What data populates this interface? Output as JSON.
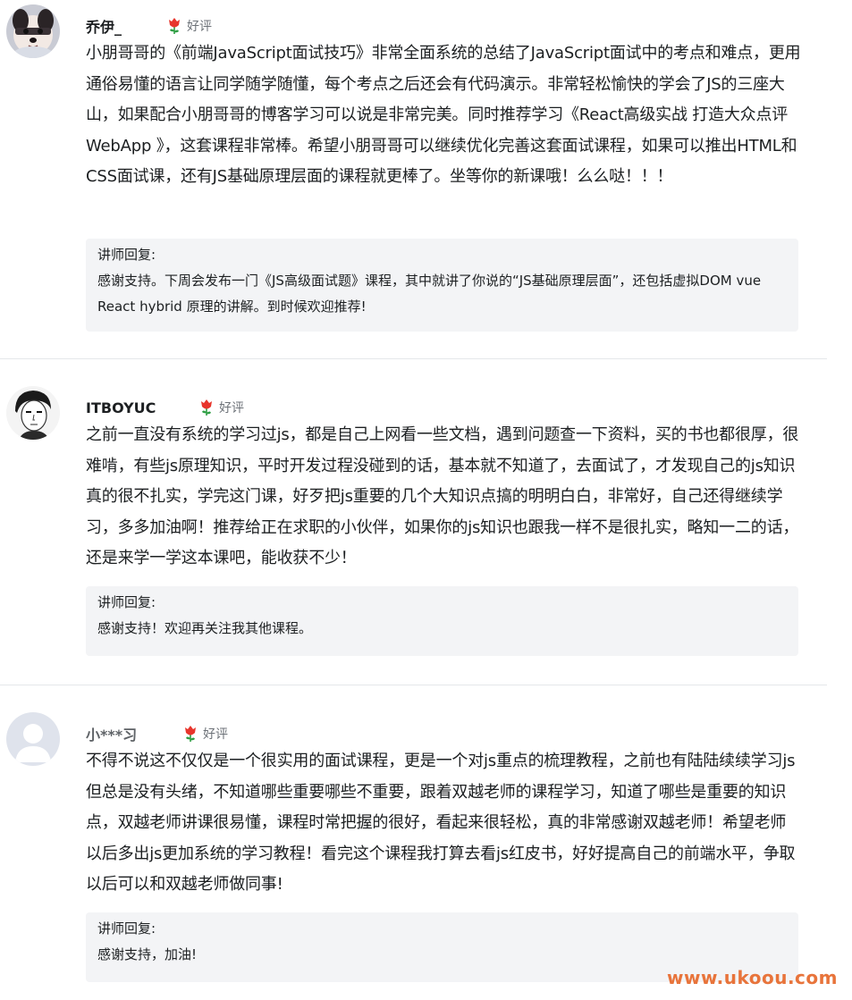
{
  "reviews": [
    {
      "username": "乔伊_",
      "avatar": "puppy-avatar",
      "rating_icon": "rose-icon",
      "rating_label": "好评",
      "content": "小朋哥哥的《前端JavaScript面试技巧》非常全面系统的总结了JavaScript面试中的考点和难点，更用通俗易懂的语言让同学随学随懂，每个考点之后还会有代码演示。非常轻松愉快的学会了JS的三座大山，如果配合小朋哥哥的博客学习可以说是非常完美。同时推荐学习《React高级实战 打造大众点评 WebApp 》，这套课程非常棒。希望小朋哥哥可以继续优化完善这套面试课程，如果可以推出HTML和CSS面试课，还有JS基础原理层面的课程就更棒了。坐等你的新课哦！么么哒！！！",
      "reply_title": "讲师回复:",
      "reply_text": "感谢支持。下周会发布一门《JS高级面试题》课程，其中就讲了你说的“JS基础原理层面”，还包括虚拟DOM vue React hybrid 原理的讲解。到时候欢迎推荐!"
    },
    {
      "username": "ITBOYUC",
      "avatar": "person-sketch-avatar",
      "rating_icon": "rose-icon",
      "rating_label": "好评",
      "content": "之前一直没有系统的学习过js，都是自己上网看一些文档，遇到问题查一下资料，买的书也都很厚，很难啃，有些js原理知识，平时开发过程没碰到的话，基本就不知道了，去面试了，才发现自己的js知识真的很不扎实，学完这门课，好歹把js重要的几个大知识点搞的明明白白，非常好，自己还得继续学习，多多加油啊！推荐给正在求职的小伙伴，如果你的js知识也跟我一样不是很扎实，略知一二的话，还是来学一学这本课吧，能收获不少！",
      "reply_title": "讲师回复:",
      "reply_text": "感谢支持！欢迎再关注我其他课程。"
    },
    {
      "username": "小***习",
      "avatar": "default-user-avatar",
      "rating_icon": "rose-icon",
      "rating_label": "好评",
      "content": "不得不说这不仅仅是一个很实用的面试课程，更是一个对js重点的梳理教程，之前也有陆陆续续学习js但总是没有头绪，不知道哪些重要哪些不重要，跟着双越老师的课程学习，知道了哪些是重要的知识点，双越老师讲课很易懂，课程时常把握的很好，看起来很轻松，真的非常感谢双越老师！希望老师以后多出js更加系统的学习教程！看完这个课程我打算去看js红皮书，好好提高自己的前端水平，争取以后可以和双越老师做同事!",
      "reply_title": "讲师回复:",
      "reply_text": "感谢支持，加油!"
    }
  ],
  "watermark": "www.ukoou.com",
  "colors": {
    "reply_bg": "#f3f4f6",
    "divider": "#e5e7ea",
    "rating_text": "#6d7278",
    "watermark": "#e8743b"
  }
}
